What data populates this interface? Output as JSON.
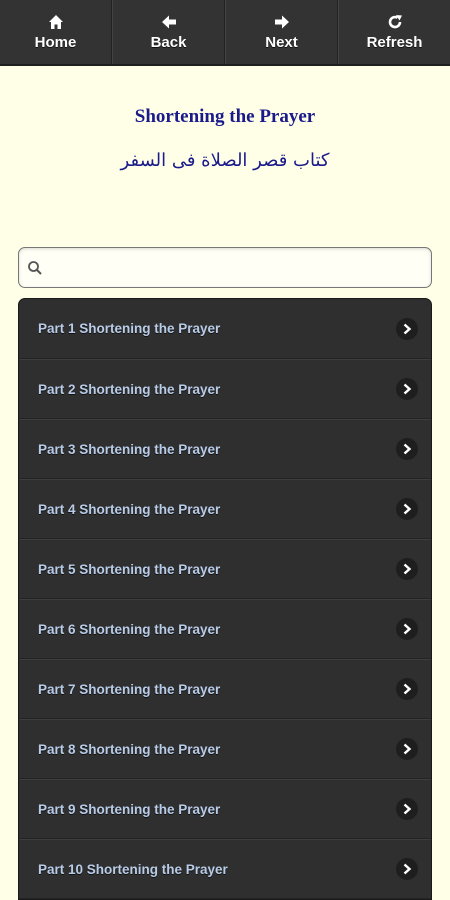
{
  "toolbar": {
    "buttons": [
      {
        "label": "Home",
        "icon": "home-icon"
      },
      {
        "label": "Back",
        "icon": "arrow-left-icon"
      },
      {
        "label": "Next",
        "icon": "arrow-right-icon"
      },
      {
        "label": "Refresh",
        "icon": "refresh-icon"
      }
    ]
  },
  "header": {
    "title": "Shortening the Prayer",
    "subtitle": "كتاب قصر الصلاة فى السفر"
  },
  "search": {
    "placeholder": "",
    "value": ""
  },
  "list": {
    "items": [
      {
        "label": "Part 1 Shortening the Prayer"
      },
      {
        "label": "Part 2 Shortening the Prayer"
      },
      {
        "label": "Part 3 Shortening the Prayer"
      },
      {
        "label": "Part 4 Shortening the Prayer"
      },
      {
        "label": "Part 5 Shortening the Prayer"
      },
      {
        "label": "Part 6 Shortening the Prayer"
      },
      {
        "label": "Part 7 Shortening the Prayer"
      },
      {
        "label": "Part 8 Shortening the Prayer"
      },
      {
        "label": "Part 9 Shortening the Prayer"
      },
      {
        "label": "Part 10 Shortening the Prayer"
      }
    ]
  },
  "colors": {
    "page_background": "#ffffe8",
    "toolbar_background": "#333333",
    "title_color": "#1a1a8a",
    "list_background": "#2f2f2f",
    "item_text": "#b8cce8"
  }
}
